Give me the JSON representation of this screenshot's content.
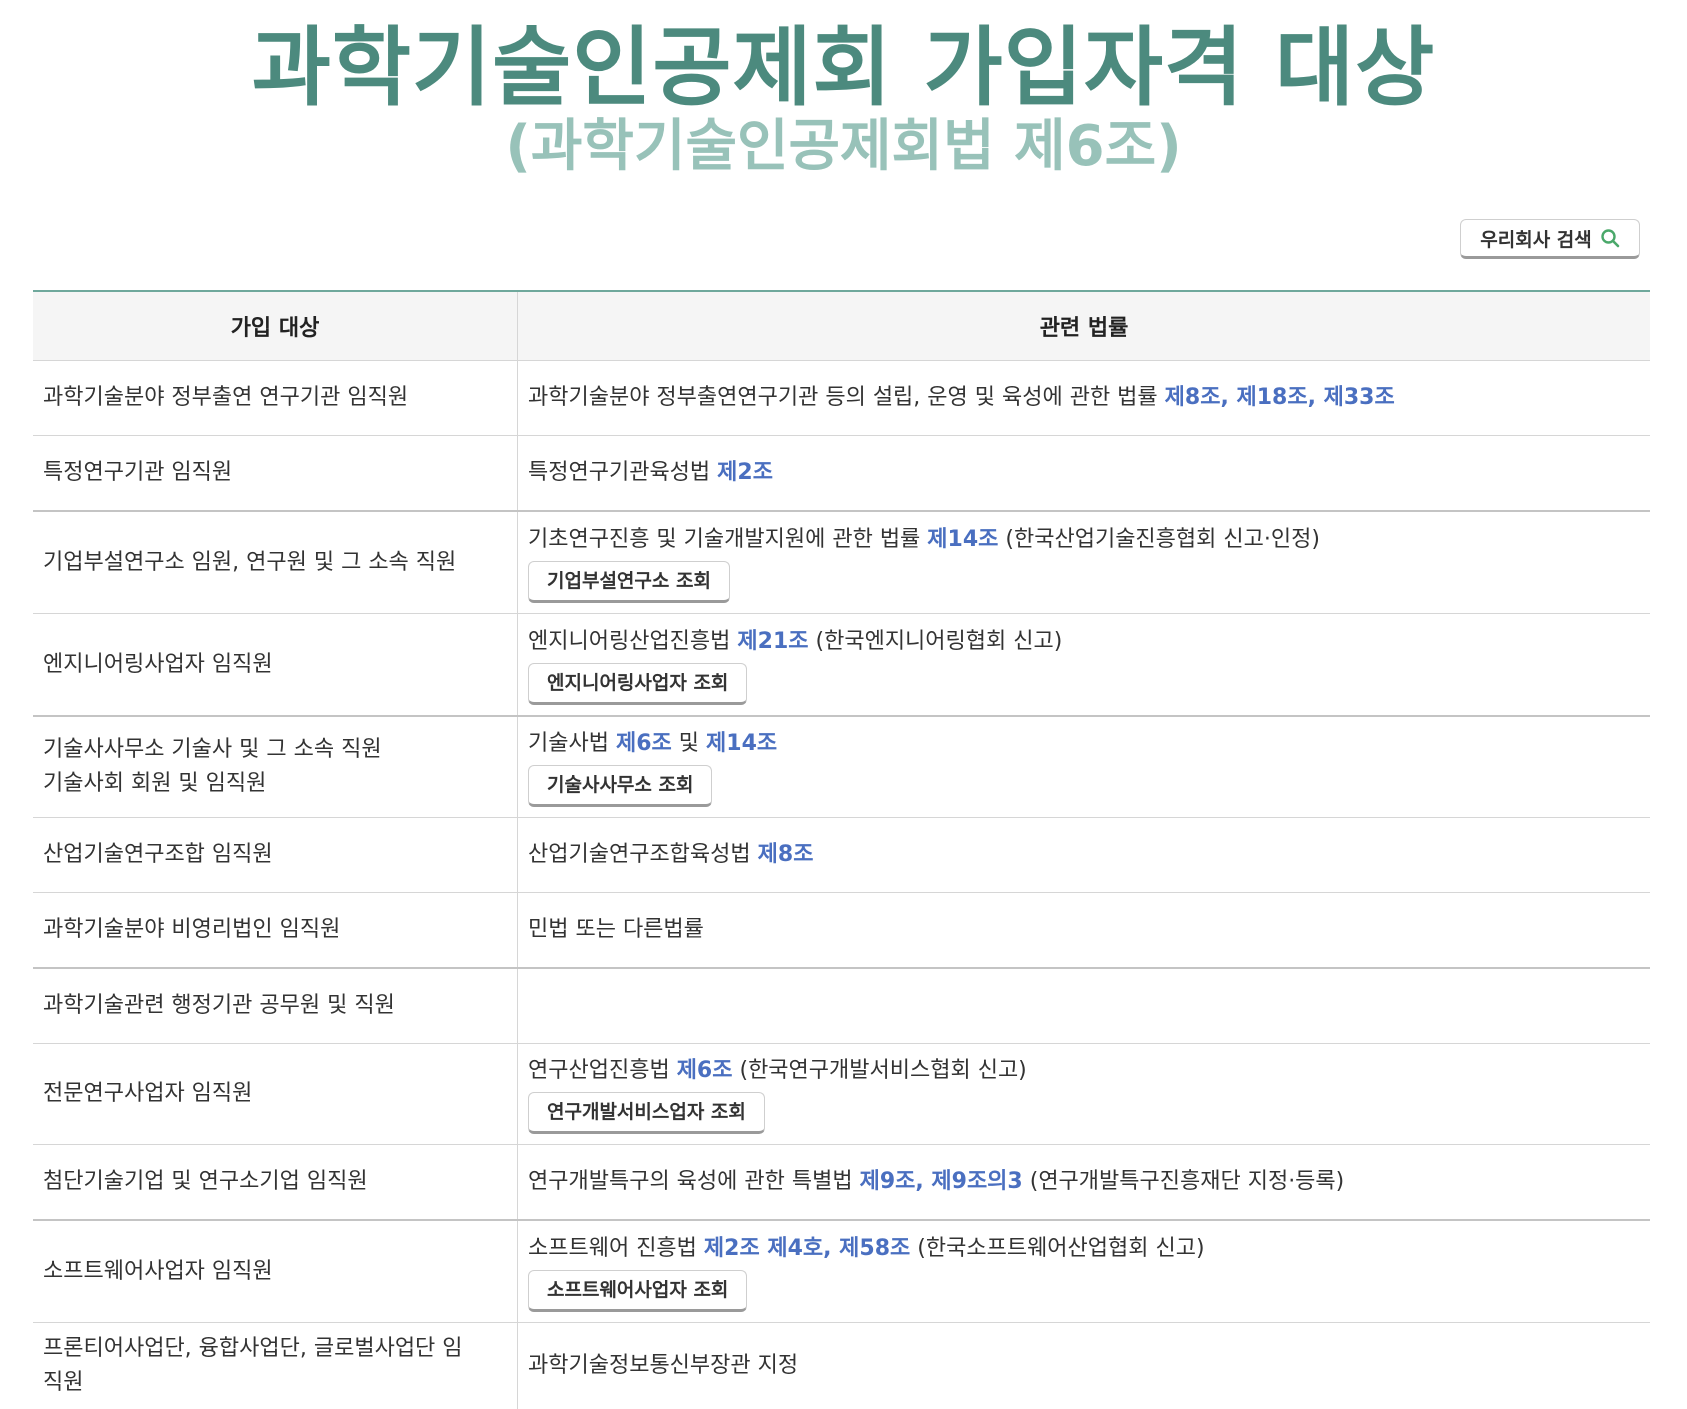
{
  "header": {
    "title": "과학기술인공제회 가입자격 대상",
    "subtitle": "(과학기술인공제회법 제6조)"
  },
  "search_button": {
    "label": "우리회사 검색",
    "icon": "search-icon",
    "icon_color": "#4aa86a"
  },
  "table": {
    "headers": [
      "가입 대상",
      "관련 법률"
    ],
    "rows": [
      {
        "target": [
          "과학기술분야 정부출연 연구기관 임직원"
        ],
        "law_text": "과학기술분야 정부출연연구기관 등의 설립, 운영 및 육성에 관한 법률",
        "articles": "제8조, 제18조, 제33조",
        "note": ""
      },
      {
        "target": [
          "특정연구기관 임직원"
        ],
        "law_text": "특정연구기관육성법",
        "articles": "제2조",
        "note": ""
      },
      {
        "target": [
          "기업부설연구소 임원, 연구원 및 그 소속 직원"
        ],
        "law_text": "기초연구진흥 및 기술개발지원에 관한 법률",
        "articles": "제14조",
        "note": "(한국산업기술진흥협회 신고·인정)",
        "button": "기업부설연구소 조회"
      },
      {
        "target": [
          "엔지니어링사업자 임직원"
        ],
        "law_text": "엔지니어링산업진흥법",
        "articles": "제21조",
        "note": "(한국엔지니어링협회 신고)",
        "button": "엔지니어링사업자 조회"
      },
      {
        "target": [
          "기술사사무소 기술사 및 그 소속 직원",
          "기술사회 회원 및 임직원"
        ],
        "law_text": "기술사법",
        "articles": "제6조",
        "connector": "및",
        "articles2": "제14조",
        "note": "",
        "button": "기술사사무소 조회"
      },
      {
        "target": [
          "산업기술연구조합 임직원"
        ],
        "law_text": "산업기술연구조합육성법",
        "articles": "제8조",
        "note": ""
      },
      {
        "target": [
          "과학기술분야 비영리법인 임직원"
        ],
        "law_text": "민법 또는 다른법률",
        "articles": "",
        "note": ""
      },
      {
        "target": [
          "과학기술관련 행정기관 공무원 및 직원"
        ],
        "law_text": "",
        "articles": "",
        "note": ""
      },
      {
        "target": [
          "전문연구사업자 임직원"
        ],
        "law_text": "연구산업진흥법",
        "articles": "제6조",
        "note": "(한국연구개발서비스협회 신고)",
        "button": "연구개발서비스업자 조회"
      },
      {
        "target": [
          "첨단기술기업 및 연구소기업 임직원"
        ],
        "law_text": "연구개발특구의 육성에 관한 특별법",
        "articles": "제9조, 제9조의3",
        "note": "(연구개발특구진흥재단 지정·등록)"
      },
      {
        "target": [
          "소프트웨어사업자 임직원"
        ],
        "law_text": "소프트웨어 진흥법",
        "articles": "제2조 제4호, 제58조",
        "note": "(한국소프트웨어산업협회 신고)",
        "button": "소프트웨어사업자 조회"
      },
      {
        "target": [
          "프론티어사업단, 융합사업단, 글로벌사업단 임",
          "직원"
        ],
        "law_text": "과학기술정보통신부장관 지정",
        "articles": "",
        "note": ""
      }
    ]
  }
}
